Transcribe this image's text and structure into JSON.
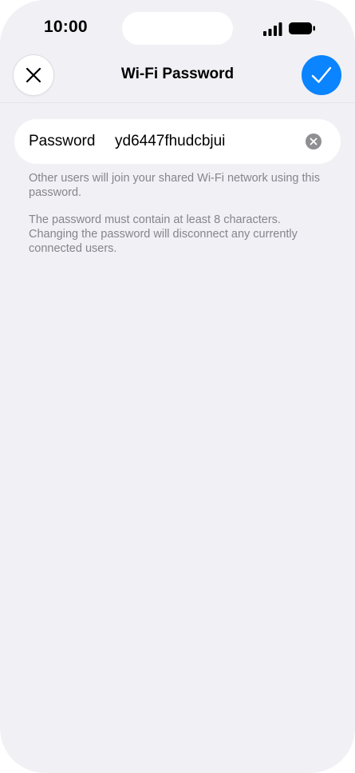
{
  "status_bar": {
    "time": "10:00",
    "icons": [
      "signal-icon",
      "battery-icon"
    ]
  },
  "nav": {
    "title": "Wi-Fi Password",
    "close_icon": "close-icon",
    "done_icon": "checkmark-icon"
  },
  "password_field": {
    "label": "Password",
    "value": "yd6447fhudcbjui",
    "clear_icon": "clear-icon"
  },
  "footnotes": [
    "Other users will join your shared Wi-Fi network using this password.",
    "The password must contain at least 8 characters. Changing the password will disconnect any currently connected users."
  ],
  "colors": {
    "background": "#f1f0f5",
    "accent": "#0a84ff",
    "secondary_text": "#85858b",
    "clear_button": "#8e8e93"
  }
}
